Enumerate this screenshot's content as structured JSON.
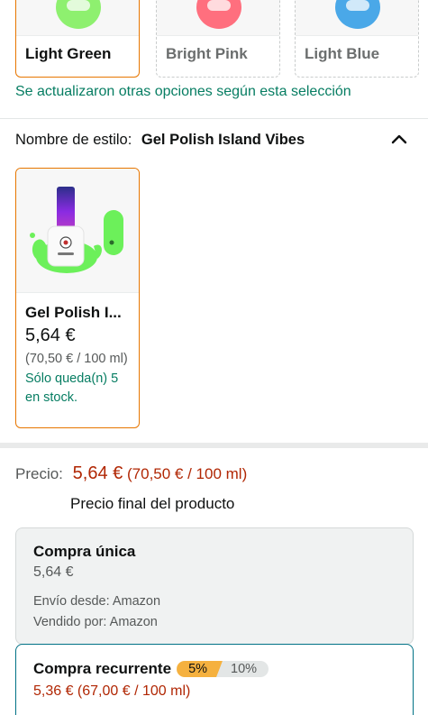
{
  "variant_colors": {
    "selected": "Light Green",
    "options": [
      {
        "label": "Light Green",
        "color": "#8ef06f",
        "state": "selected"
      },
      {
        "label": "Bright Pink",
        "color": "#ff6f7e",
        "state": "unavailable"
      },
      {
        "label": "Light Blue",
        "color": "#4aa8e8",
        "state": "unavailable"
      }
    ],
    "update_note": "Se actualizaron otras opciones según esta selección"
  },
  "style": {
    "label": "Nombre de estilo:",
    "value": "Gel Polish Island Vibes",
    "collapse_icon": "chevron-up-icon"
  },
  "product_card": {
    "title": "Gel Polish I...",
    "price": "5,64 €",
    "unit_price": "(70,50 € / 100 ml)",
    "stock": "Sólo queda(n) 5 en stock."
  },
  "pricing": {
    "label": "Precio:",
    "price": "5,64 €",
    "unit_price": "(70,50 € / 100 ml)",
    "final_note": "Precio final del producto"
  },
  "buy_once": {
    "title": "Compra única",
    "price": "5,64 €",
    "shipping": "Envío desde: Amazon",
    "seller": "Vendido por: Amazon"
  },
  "buy_recurring": {
    "title": "Compra recurrente",
    "discount_selected": "5%",
    "discount_other": "10%",
    "price": "5,36 € (67,00 € / 100 ml)"
  },
  "colors": {
    "accent_orange": "#e77600",
    "success_green": "#067d62",
    "price_red": "#b12704",
    "teal_border": "#007185",
    "badge_yellow": "#f5b13f"
  }
}
